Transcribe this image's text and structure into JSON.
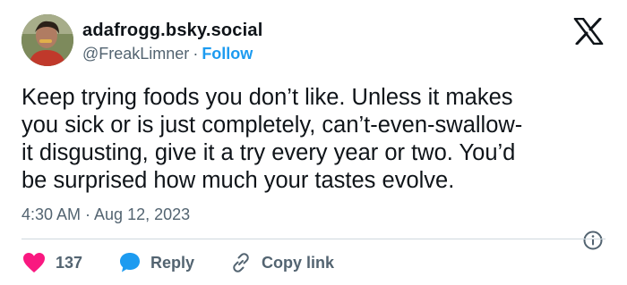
{
  "author": {
    "display_name": "adafrogg.bsky.social",
    "handle": "@FreakLimner",
    "separator": "·",
    "follow_label": "Follow"
  },
  "post": {
    "text_lines": [
      "Keep trying foods you don’t like. Unless it makes",
      "you sick or is just completely, can’t-even-swallow-",
      "it disgusting, give it a try every year or two. You’d",
      "be surprised how much your tastes evolve."
    ],
    "timestamp": "4:30 AM · Aug 12, 2023"
  },
  "actions": {
    "likes_count": "137",
    "reply_label": "Reply",
    "copy_link_label": "Copy link"
  },
  "icons": {
    "brand": "x-logo-icon",
    "like": "heart-icon",
    "reply": "speech-bubble-icon",
    "copy": "link-icon",
    "info": "info-icon"
  },
  "colors": {
    "text": "#0f1419",
    "secondary": "#536471",
    "accent": "#1d9bf0",
    "like": "#f91880",
    "divider": "#cfd9de"
  }
}
